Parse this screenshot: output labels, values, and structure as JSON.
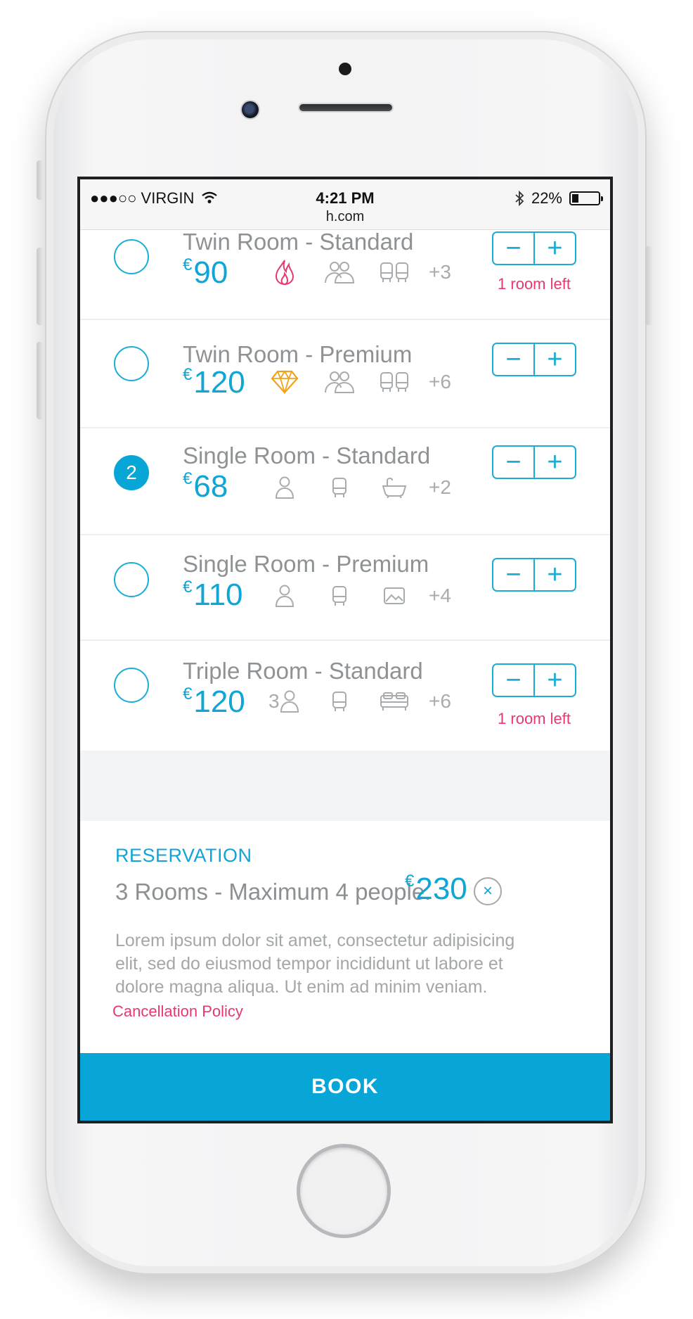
{
  "status_bar": {
    "carrier": "●●●○○ VIRGIN",
    "time": "4:21 PM",
    "url": "h.com",
    "battery": "22%"
  },
  "rooms": [
    {
      "name": "Twin Room - Standard",
      "currency": "€",
      "price": "90",
      "selected": false,
      "selected_count": "",
      "amenities": [
        "flame-icon",
        "two-people-icon",
        "two-seats-icon"
      ],
      "more": "+3",
      "note": "1 room left",
      "decrease": "−",
      "increase": "+"
    },
    {
      "name": "Twin Room - Premium",
      "currency": "€",
      "price": "120",
      "selected": false,
      "selected_count": "",
      "amenities": [
        "diamond-icon",
        "two-people-icon",
        "two-seats-icon"
      ],
      "more": "+6",
      "note": "",
      "decrease": "−",
      "increase": "+"
    },
    {
      "name": "Single Room - Standard",
      "currency": "€",
      "price": "68",
      "selected": true,
      "selected_count": "2",
      "amenities": [
        "person-icon",
        "seat-icon",
        "bathtub-icon"
      ],
      "more": "+2",
      "note": "",
      "decrease": "−",
      "increase": "+"
    },
    {
      "name": "Single Room - Premium",
      "currency": "€",
      "price": "110",
      "selected": false,
      "selected_count": "",
      "amenities": [
        "person-icon",
        "seat-icon",
        "picture-icon"
      ],
      "more": "+4",
      "note": "",
      "decrease": "−",
      "increase": "+"
    },
    {
      "name": "Triple Room - Standard",
      "currency": "€",
      "price": "120",
      "selected": false,
      "selected_count": "",
      "people_count": "3",
      "amenities": [
        "person-icon",
        "seat-icon",
        "bed-icon"
      ],
      "more": "+6",
      "note": "1 room left",
      "decrease": "−",
      "increase": "+"
    }
  ],
  "reservation": {
    "label": "RESERVATION",
    "summary": "3 Rooms - Maximum 4 people.",
    "currency": "€",
    "total": "230",
    "close": "×",
    "description": "Lorem ipsum dolor sit amet, consectetur adipisicing elit, sed do eiusmod tempor incididunt ut labore et dolore magna aliqua. Ut enim ad minim veniam.",
    "policy_link": "Cancellation Policy"
  },
  "book_button": "BOOK",
  "colors": {
    "accent": "#07a6d6",
    "alert": "#e63a6e",
    "flame": "#e63a6e",
    "diamond": "#f0a21a",
    "muted": "#8f9294"
  }
}
